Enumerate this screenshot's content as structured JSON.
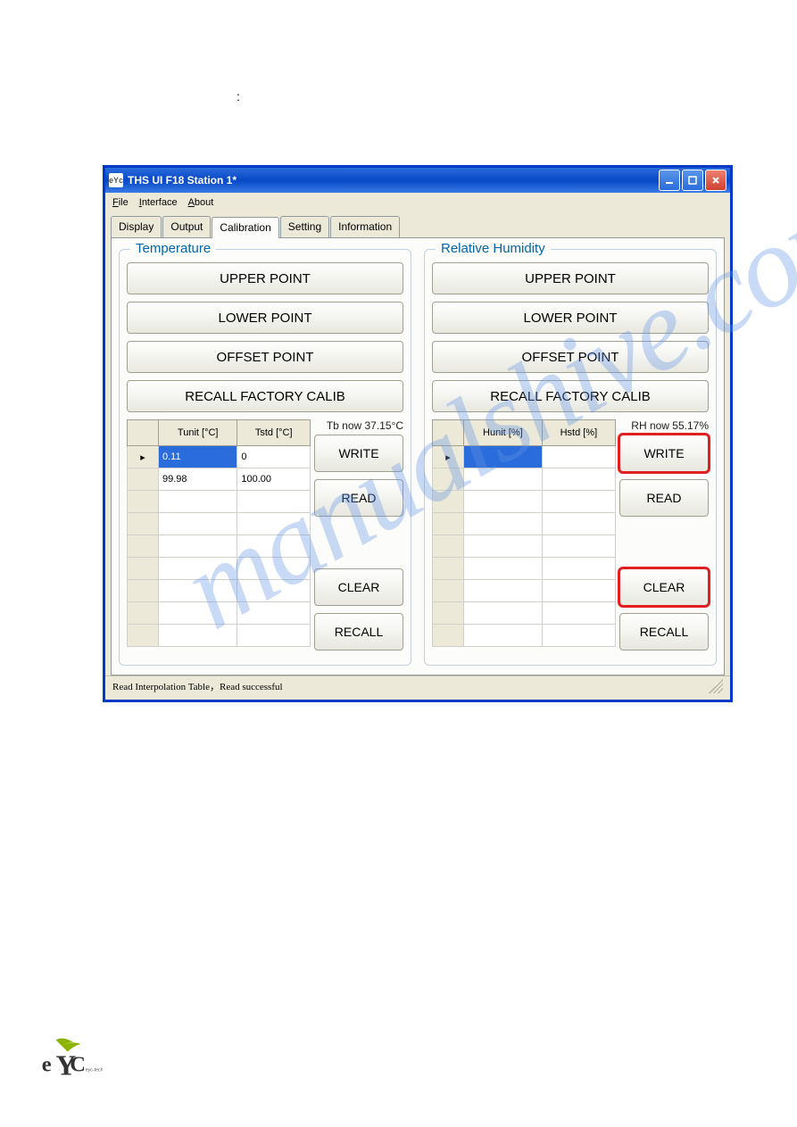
{
  "window": {
    "title": "THS UI F18  Station 1*",
    "icon": "eYc"
  },
  "menu": {
    "file": "File",
    "interface": "Interface",
    "about": "About"
  },
  "tabs": {
    "display": "Display",
    "output": "Output",
    "calibration": "Calibration",
    "setting": "Setting",
    "information": "Information",
    "active": "calibration"
  },
  "temperature": {
    "title": "Temperature",
    "buttons": {
      "upper": "UPPER POINT",
      "lower": "LOWER POINT",
      "offset": "OFFSET POINT",
      "recallFactory": "RECALL FACTORY CALIB"
    },
    "now": "Tb now 37.15°C",
    "grid": {
      "col1": "Tunit [°C]",
      "col2": "Tstd [°C]",
      "rows": [
        [
          "0.11",
          "0"
        ],
        [
          "99.98",
          "100.00"
        ],
        [
          "",
          ""
        ],
        [
          "",
          ""
        ],
        [
          "",
          ""
        ],
        [
          "",
          ""
        ],
        [
          "",
          ""
        ],
        [
          "",
          ""
        ],
        [
          "",
          ""
        ]
      ]
    },
    "side": {
      "write": "WRITE",
      "read": "READ",
      "clear": "CLEAR",
      "recall": "RECALL"
    }
  },
  "humidity": {
    "title": "Relative Humidity",
    "buttons": {
      "upper": "UPPER POINT",
      "lower": "LOWER POINT",
      "offset": "OFFSET POINT",
      "recallFactory": "RECALL FACTORY CALIB"
    },
    "now": "RH now 55.17%",
    "grid": {
      "col1": "Hunit [%]",
      "col2": "Hstd [%]",
      "rows": [
        [
          "",
          ""
        ],
        [
          "",
          ""
        ],
        [
          "",
          ""
        ],
        [
          "",
          ""
        ],
        [
          "",
          ""
        ],
        [
          "",
          ""
        ],
        [
          "",
          ""
        ],
        [
          "",
          ""
        ],
        [
          "",
          ""
        ]
      ]
    },
    "side": {
      "write": "WRITE",
      "read": "READ",
      "clear": "CLEAR",
      "recall": "RECALL"
    }
  },
  "status": "Read Interpolation Table，Read successful",
  "watermark": "manualshive.com"
}
